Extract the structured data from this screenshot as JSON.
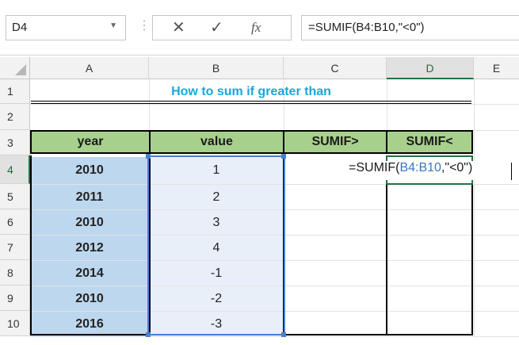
{
  "formula_bar": {
    "name_box": "D4",
    "formula": "=SUMIF(B4:B10,\"<0\")",
    "cancel_icon": "close-icon",
    "enter_icon": "check-icon",
    "fx_label": "fx"
  },
  "columns": [
    "A",
    "B",
    "C",
    "D",
    "E"
  ],
  "rows": [
    "1",
    "2",
    "3",
    "4",
    "5",
    "6",
    "7",
    "8",
    "9",
    "10"
  ],
  "sheet": {
    "title": "How to sum if greater than",
    "headers": [
      "year",
      "value",
      "SUMIF>",
      "SUMIF<"
    ],
    "data": [
      {
        "year": "2010",
        "value": "1"
      },
      {
        "year": "2011",
        "value": "2"
      },
      {
        "year": "2010",
        "value": "3"
      },
      {
        "year": "2012",
        "value": "4"
      },
      {
        "year": "2014",
        "value": "-1"
      },
      {
        "year": "2010",
        "value": "-2"
      },
      {
        "year": "2016",
        "value": "-3"
      }
    ],
    "editing": {
      "prefix": "=SUMIF(",
      "range": "B4:B10",
      "suffix": ",\"<0\")"
    }
  },
  "colors": {
    "title": "#19a7d9",
    "header_fill": "#a8d08d",
    "year_fill": "#bdd7ee",
    "value_fill": "#e9eff9",
    "selection": "#4a7fd0",
    "active_cell": "#217346"
  }
}
